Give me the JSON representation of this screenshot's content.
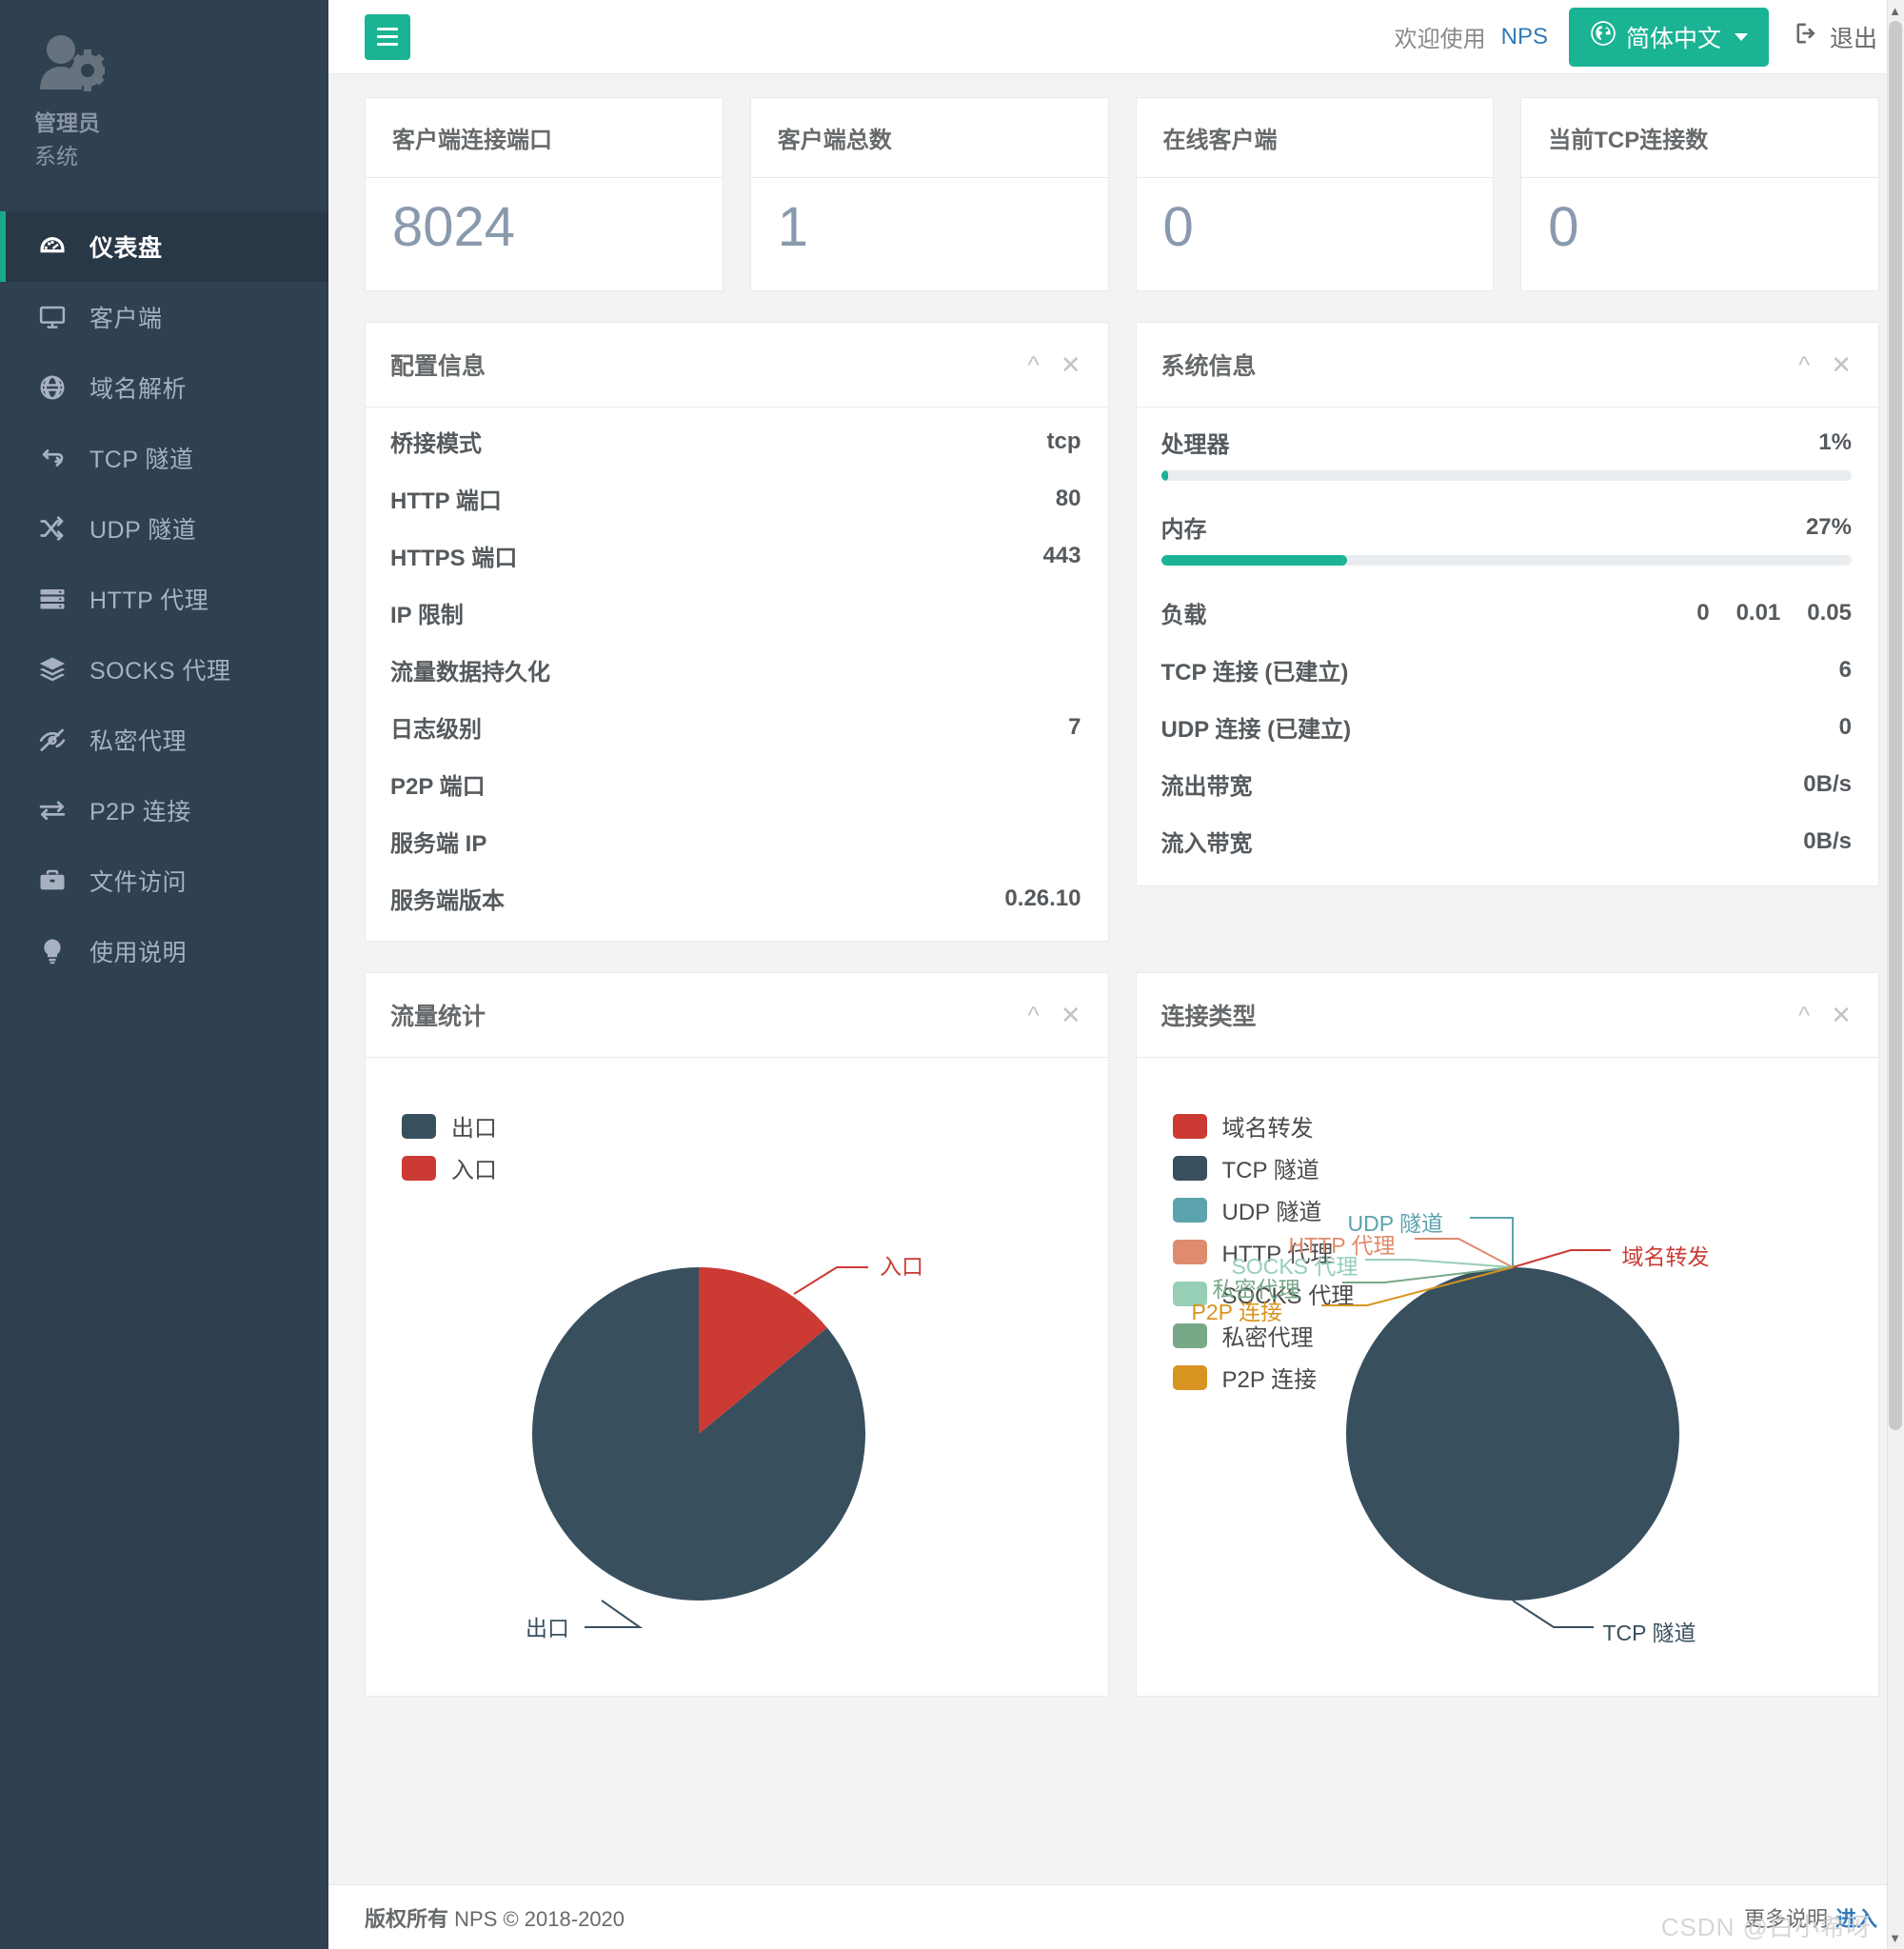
{
  "sidebar": {
    "profile": {
      "name": "管理员",
      "sub": "系统",
      "avatar_icon": "user-gear-icon"
    },
    "items": [
      {
        "label": "仪表盘",
        "icon": "dashboard-icon",
        "active": true
      },
      {
        "label": "客户端",
        "icon": "monitor-icon",
        "active": false
      },
      {
        "label": "域名解析",
        "icon": "globe-icon",
        "active": false
      },
      {
        "label": "TCP 隧道",
        "icon": "exchange-arrows-icon",
        "active": false
      },
      {
        "label": "UDP 隧道",
        "icon": "shuffle-icon",
        "active": false
      },
      {
        "label": "HTTP 代理",
        "icon": "server-icon",
        "active": false
      },
      {
        "label": "SOCKS 代理",
        "icon": "layers-icon",
        "active": false
      },
      {
        "label": "私密代理",
        "icon": "eye-slash-icon",
        "active": false
      },
      {
        "label": "P2P 连接",
        "icon": "arrows-h-icon",
        "active": false
      },
      {
        "label": "文件访问",
        "icon": "briefcase-icon",
        "active": false
      },
      {
        "label": "使用说明",
        "icon": "lightbulb-icon",
        "active": false
      }
    ]
  },
  "topbar": {
    "menu_toggle_icon": "hamburger-icon",
    "welcome": "欢迎使用",
    "brand_link": "NPS",
    "language_label": "简体中文",
    "language_icon": "globe-icon",
    "logout_label": "退出",
    "logout_icon": "sign-out-icon"
  },
  "stats": [
    {
      "title": "客户端连接端口",
      "value": "8024"
    },
    {
      "title": "客户端总数",
      "value": "1"
    },
    {
      "title": "在线客户端",
      "value": "0"
    },
    {
      "title": "当前TCP连接数",
      "value": "0"
    }
  ],
  "config_panel": {
    "title": "配置信息",
    "collapse_icon": "chevron-up-icon",
    "close_icon": "close-icon",
    "rows": [
      {
        "key": "桥接模式",
        "value": "tcp"
      },
      {
        "key": "HTTP 端口",
        "value": "80"
      },
      {
        "key": "HTTPS 端口",
        "value": "443"
      },
      {
        "key": "IP 限制",
        "value": ""
      },
      {
        "key": "流量数据持久化",
        "value": ""
      },
      {
        "key": "日志级别",
        "value": "7"
      },
      {
        "key": "P2P 端口",
        "value": ""
      },
      {
        "key": "服务端 IP",
        "value": ""
      },
      {
        "key": "服务端版本",
        "value": "0.26.10"
      }
    ]
  },
  "system_panel": {
    "title": "系统信息",
    "collapse_icon": "chevron-up-icon",
    "close_icon": "close-icon",
    "cpu": {
      "label": "处理器",
      "value": "1%",
      "percent": 1
    },
    "mem": {
      "label": "内存",
      "value": "27%",
      "percent": 27
    },
    "load": {
      "label": "负载",
      "v1": "0",
      "v2": "0.01",
      "v3": "0.05"
    },
    "rows": [
      {
        "key": "TCP 连接 (已建立)",
        "value": "6"
      },
      {
        "key": "UDP 连接 (已建立)",
        "value": "0"
      },
      {
        "key": "流出带宽",
        "value": "0B/s"
      },
      {
        "key": "流入带宽",
        "value": "0B/s"
      }
    ]
  },
  "traffic_panel": {
    "title": "流量统计",
    "collapse_icon": "chevron-up-icon",
    "close_icon": "close-icon"
  },
  "conn_panel": {
    "title": "连接类型",
    "collapse_icon": "chevron-up-icon",
    "close_icon": "close-icon"
  },
  "footer": {
    "copyright_bold": "版权所有",
    "copyright_rest": "NPS © 2018-2020",
    "more_label": "更多说明",
    "enter_label": "进入",
    "watermark": "CSDN @白小希呀"
  },
  "chart_data": [
    {
      "type": "pie",
      "title": "流量统计",
      "legend_position": "top-left",
      "categories": [
        "出口",
        "入口"
      ],
      "values": [
        86,
        14
      ],
      "colors": [
        "#384f5e",
        "#cb3a33"
      ],
      "labels": [
        "出口",
        "入口"
      ]
    },
    {
      "type": "pie",
      "title": "连接类型",
      "legend_position": "top-left",
      "categories": [
        "域名转发",
        "TCP 隧道",
        "UDP 隧道",
        "HTTP 代理",
        "SOCKS 代理",
        "私密代理",
        "P2P 连接"
      ],
      "values": [
        0,
        100,
        0,
        0,
        0,
        0,
        0
      ],
      "colors": [
        "#cb3a33",
        "#384f5e",
        "#5ba3ad",
        "#df8b6d",
        "#97ceb6",
        "#77a888",
        "#d89420"
      ],
      "labels": [
        "域名转发",
        "TCP 隧道",
        "UDP 隧道",
        "HTTP 代理",
        "SOCKS 代理",
        "私密代理",
        "P2P 连接"
      ]
    }
  ]
}
